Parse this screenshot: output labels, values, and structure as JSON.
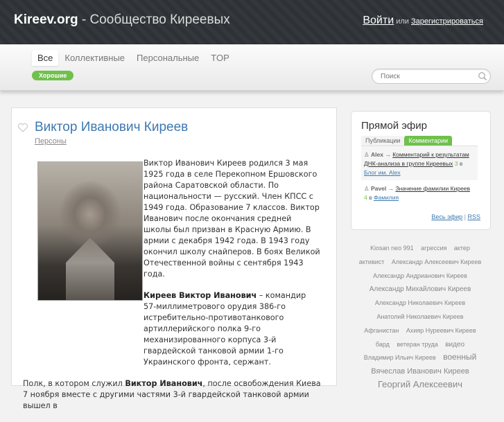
{
  "header": {
    "logo_bold": "Kireev.org",
    "logo_rest": " - Сообщество Киреевых",
    "login_label": "Войти",
    "or_label": "или",
    "register_label": "Зарегистрироваться"
  },
  "nav": {
    "tabs": [
      {
        "label": "Все",
        "active": true
      },
      {
        "label": "Коллективные",
        "active": false
      },
      {
        "label": "Персональные",
        "active": false
      },
      {
        "label": "TOP",
        "active": false
      }
    ],
    "filter_badge": "Хорошие",
    "search_placeholder": "Поиск"
  },
  "article": {
    "title": "Виктор Иванович Киреев",
    "category": "Персоны",
    "paragraph1": "Виктор Иванович Киреев родился 3 мая 1925 года в селе Перекопном Ершовского района Саратовской области. По национальности — русский. Член КПСС с 1949 года. Образование 7 классов. Виктор Иванович после окончания средней школы был призван в Красную Армию. В армии с декабря 1942 года. В 1943 году окончил школу снайперов. В боях Великой Отечественной войны с сентября 1943 года.",
    "paragraph2_bold": "Киреев Виктор Иванович",
    "paragraph2_rest": " – командир 57-миллиметрового орудия 386-го истребительно-противотанкового артиллерийского полка 9-го механизированного корпуса 3-й гвардейской танковой армии 1-го Украинского фронта, сержант.",
    "paragraph3_start": "Полк, в котором служил ",
    "paragraph3_bold": "Виктор Иванович",
    "paragraph3_rest": ", после освобождения Киева 7 ноября вместе с другими частями 3-й гвардейской танковой армии вышел в"
  },
  "live": {
    "title": "Прямой эфир",
    "tabs": [
      {
        "label": "Публикации",
        "active": false
      },
      {
        "label": "Комментарии",
        "active": true
      }
    ],
    "items": [
      {
        "user": "Alex",
        "arrow": "→",
        "link": "Комментарий к результатам ДНК-анализа в группе Киреевых",
        "count": "3",
        "in_label": "в",
        "blog": "Блог им. Alex"
      },
      {
        "user": "Pavel",
        "arrow": "→",
        "link": "Значение фамилии Киреев",
        "count": "4",
        "in_label": "в",
        "blog": "Фамилия"
      }
    ],
    "all_label": "Весь эфир",
    "separator": "|",
    "rss_label": "RSS"
  },
  "tags": [
    {
      "text": "Kiosan neo 991",
      "size": 9
    },
    {
      "text": "агрессия",
      "size": 9
    },
    {
      "text": "актер",
      "size": 9
    },
    {
      "text": "активист",
      "size": 9
    },
    {
      "text": "Александр Алексеевич Киреев",
      "size": 9
    },
    {
      "text": "Александр Андрианович Киреев",
      "size": 9
    },
    {
      "text": "Александр Михайлович Киреев",
      "size": 10
    },
    {
      "text": "Александр Николаевич Киреев",
      "size": 9
    },
    {
      "text": "Анатолий Николаевич Киреев",
      "size": 9
    },
    {
      "text": "Афганистан",
      "size": 9
    },
    {
      "text": "Ахияр Нуреевич Киреев",
      "size": 9
    },
    {
      "text": "бард",
      "size": 9
    },
    {
      "text": "ветеран труда",
      "size": 9
    },
    {
      "text": "видео",
      "size": 10
    },
    {
      "text": "Владимир Ильич Киреев",
      "size": 9
    },
    {
      "text": "военный",
      "size": 12
    },
    {
      "text": "Вячеслав Иванович Киреев",
      "size": 11
    },
    {
      "text": "Георгий Алексеевич",
      "size": 13
    }
  ]
}
